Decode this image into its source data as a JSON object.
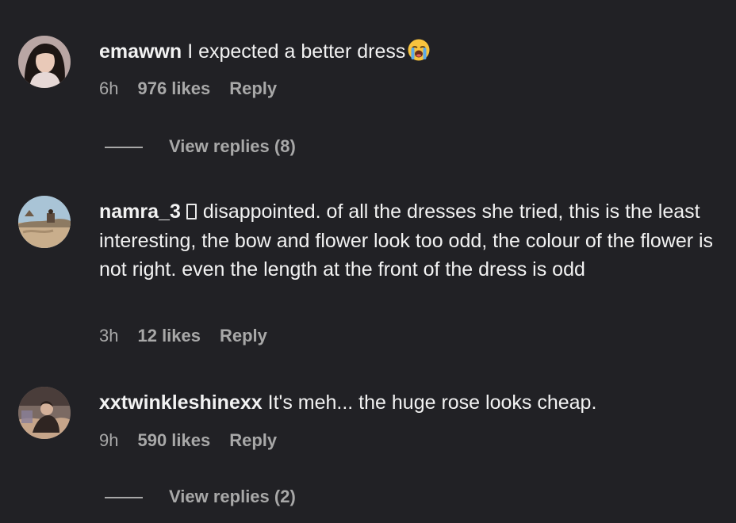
{
  "comments": [
    {
      "username": "emawwn",
      "text": "I expected a better dress",
      "emoji": "loudly-crying-face-icon",
      "time": "6h",
      "likes": "976 likes",
      "reply": "Reply",
      "view_replies": "View replies (8)"
    },
    {
      "username": "namra_3",
      "text": "disappointed. of all the dresses she tried, this is the least interesting, the bow and flower look too odd, the colour of the flower is not right. even the length at the front of the dress is odd",
      "time": "3h",
      "likes": "12 likes",
      "reply": "Reply"
    },
    {
      "username": "xxtwinkleshinexx",
      "text": "It's meh... the huge rose looks cheap.",
      "time": "9h",
      "likes": "590 likes",
      "reply": "Reply",
      "view_replies": "View replies (2)"
    }
  ],
  "colors": {
    "background": "#212125",
    "primary_text": "#f2f2f2",
    "secondary_text": "#a8a8a8"
  }
}
